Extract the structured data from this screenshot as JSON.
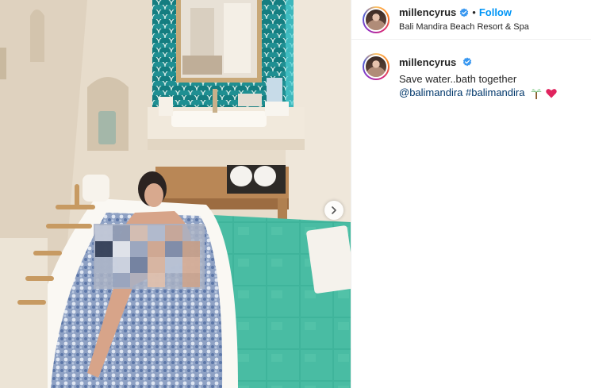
{
  "post": {
    "username": "millencyrus",
    "verified": true,
    "separator": "•",
    "follow_label": "Follow",
    "location": "Bali Mandira Beach Resort & Spa"
  },
  "caption": {
    "username": "millencyrus",
    "text": "Save water..bath together",
    "mention": "@balimandira",
    "hashtag": "#balimandira",
    "emojis": [
      "palm-tree",
      "red-heart"
    ]
  },
  "icons": {
    "verified": "verified-badge-icon",
    "next": "chevron-right-icon"
  },
  "colors": {
    "link_blue": "#0095f6",
    "tag_blue": "#00376b",
    "verified_blue": "#3897f0",
    "heart_red": "#e0245e"
  }
}
